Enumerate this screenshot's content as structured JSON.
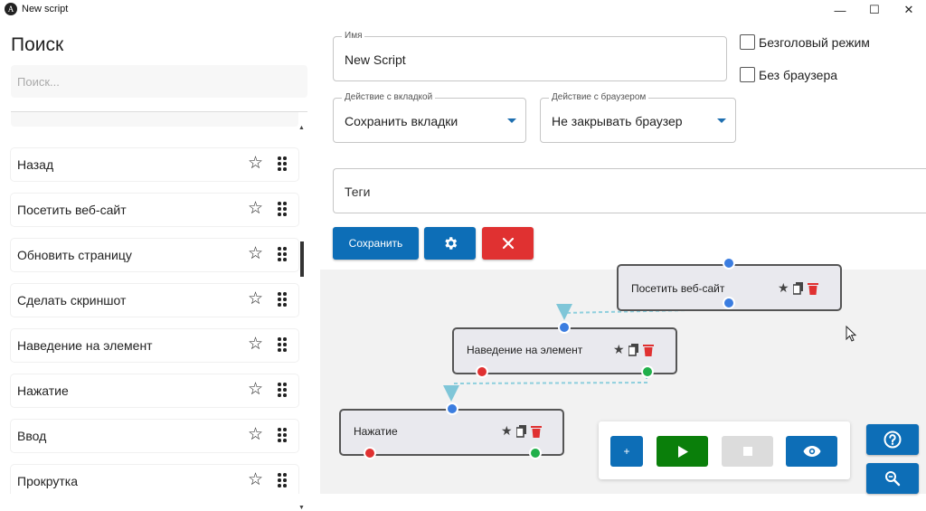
{
  "window": {
    "title": "New script",
    "controls": {
      "minimize": "—",
      "maximize": "☐",
      "close": "✕"
    }
  },
  "sidebar": {
    "title": "Поиск",
    "search_placeholder": "Поиск...",
    "items": [
      {
        "label": "Назад",
        "icon": "star-outline-icon"
      },
      {
        "label": "Посетить веб-сайт",
        "icon": "star-outline-icon"
      },
      {
        "label": "Обновить страницу",
        "icon": "star-outline-icon"
      },
      {
        "label": "Сделать скриншот",
        "icon": "star-outline-icon"
      },
      {
        "label": "Наведение на элемент",
        "icon": "star-outline-icon"
      },
      {
        "label": "Нажатие",
        "icon": "star-outline-icon"
      },
      {
        "label": "Ввод",
        "icon": "star-outline-icon"
      },
      {
        "label": "Прокрутка",
        "icon": "star-outline-icon"
      }
    ]
  },
  "form": {
    "name": {
      "label": "Имя",
      "value": "New Script"
    },
    "tab_action": {
      "label": "Действие с вкладкой",
      "value": "Сохранить вкладки"
    },
    "browser_action": {
      "label": "Действие с браузером",
      "value": "Не закрывать браузер"
    },
    "headless": {
      "label": "Безголовый режим",
      "checked": false
    },
    "no_browser": {
      "label": "Без браузера",
      "checked": false
    },
    "tags": {
      "placeholder": "Теги"
    },
    "save_label": "Сохранить"
  },
  "flow": {
    "nodes": [
      {
        "label": "Посетить веб-сайт"
      },
      {
        "label": "Наведение на элемент"
      },
      {
        "label": "Нажатие"
      }
    ]
  },
  "controls": {
    "add_label": "+"
  },
  "colors": {
    "primary": "#0d6eb7",
    "danger": "#e03131",
    "run": "#0a7f0a",
    "disabled": "#dcdcdc",
    "dot_blue": "#3b7de0",
    "dot_red": "#e03131",
    "dot_green": "#21b04b",
    "edge": "#8ecfdd"
  }
}
